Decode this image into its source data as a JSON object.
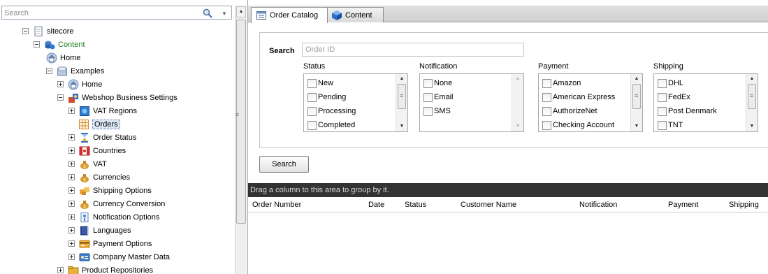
{
  "tree_search": {
    "placeholder": "Search"
  },
  "tree": [
    {
      "label": "sitecore",
      "expander": "minus",
      "icon": "page-icon"
    },
    {
      "label": "Content",
      "expander": "minus",
      "icon": "content-db-icon",
      "color": "#1e7a1e"
    },
    {
      "label": "Home",
      "expander": "",
      "icon": "home-icon"
    },
    {
      "label": "Examples",
      "expander": "minus",
      "icon": "examples-folder-icon"
    },
    {
      "label": "Home",
      "expander": "plus",
      "icon": "home-icon"
    },
    {
      "label": "Webshop Business Settings",
      "expander": "minus",
      "icon": "webshop-settings-icon"
    },
    {
      "label": "VAT Regions",
      "expander": "plus",
      "icon": "vat-regions-icon"
    },
    {
      "label": "Orders",
      "expander": "",
      "icon": "orders-grid-icon",
      "selected": true
    },
    {
      "label": "Order Status",
      "expander": "plus",
      "icon": "hourglass-icon"
    },
    {
      "label": "Countries",
      "expander": "plus",
      "icon": "flag-icon"
    },
    {
      "label": "VAT",
      "expander": "plus",
      "icon": "money-bag-icon"
    },
    {
      "label": "Currencies",
      "expander": "plus",
      "icon": "money-bag-icon"
    },
    {
      "label": "Shipping Options",
      "expander": "plus",
      "icon": "shipping-icon"
    },
    {
      "label": "Currency Conversion",
      "expander": "plus",
      "icon": "money-bag-icon"
    },
    {
      "label": "Notification Options",
      "expander": "plus",
      "icon": "notification-icon"
    },
    {
      "label": "Languages",
      "expander": "plus",
      "icon": "languages-book-icon"
    },
    {
      "label": "Payment Options",
      "expander": "plus",
      "icon": "payment-icon"
    },
    {
      "label": "Company Master Data",
      "expander": "plus",
      "icon": "company-data-icon"
    },
    {
      "label": "Product Repositories",
      "expander": "plus",
      "icon": "product-folder-icon"
    }
  ],
  "tabs": [
    {
      "label": "Order Catalog",
      "active": true,
      "icon": "order-catalog-icon"
    },
    {
      "label": "Content",
      "active": false,
      "icon": "content-cube-icon"
    }
  ],
  "filter": {
    "search_label": "Search",
    "order_id_placeholder": "Order ID",
    "groups": [
      {
        "title": "Status",
        "items": [
          "New",
          "Pending",
          "Processing",
          "Completed"
        ],
        "scroll": "enabled"
      },
      {
        "title": "Notification",
        "items": [
          "None",
          "Email",
          "SMS"
        ],
        "scroll": "disabled"
      },
      {
        "title": "Payment",
        "items": [
          "Amazon",
          "American Express",
          "AuthorizeNet",
          "Checking Account"
        ],
        "scroll": "enabled"
      },
      {
        "title": "Shipping",
        "items": [
          "DHL",
          "FedEx",
          "Post Denmark",
          "TNT"
        ],
        "scroll": "enabled"
      }
    ]
  },
  "search_button": "Search",
  "grid": {
    "group_hint": "Drag a column to this area to group by it.",
    "columns": [
      "Order Number",
      "Date",
      "Status",
      "Customer Name",
      "Notification",
      "Payment",
      "Shipping"
    ]
  }
}
